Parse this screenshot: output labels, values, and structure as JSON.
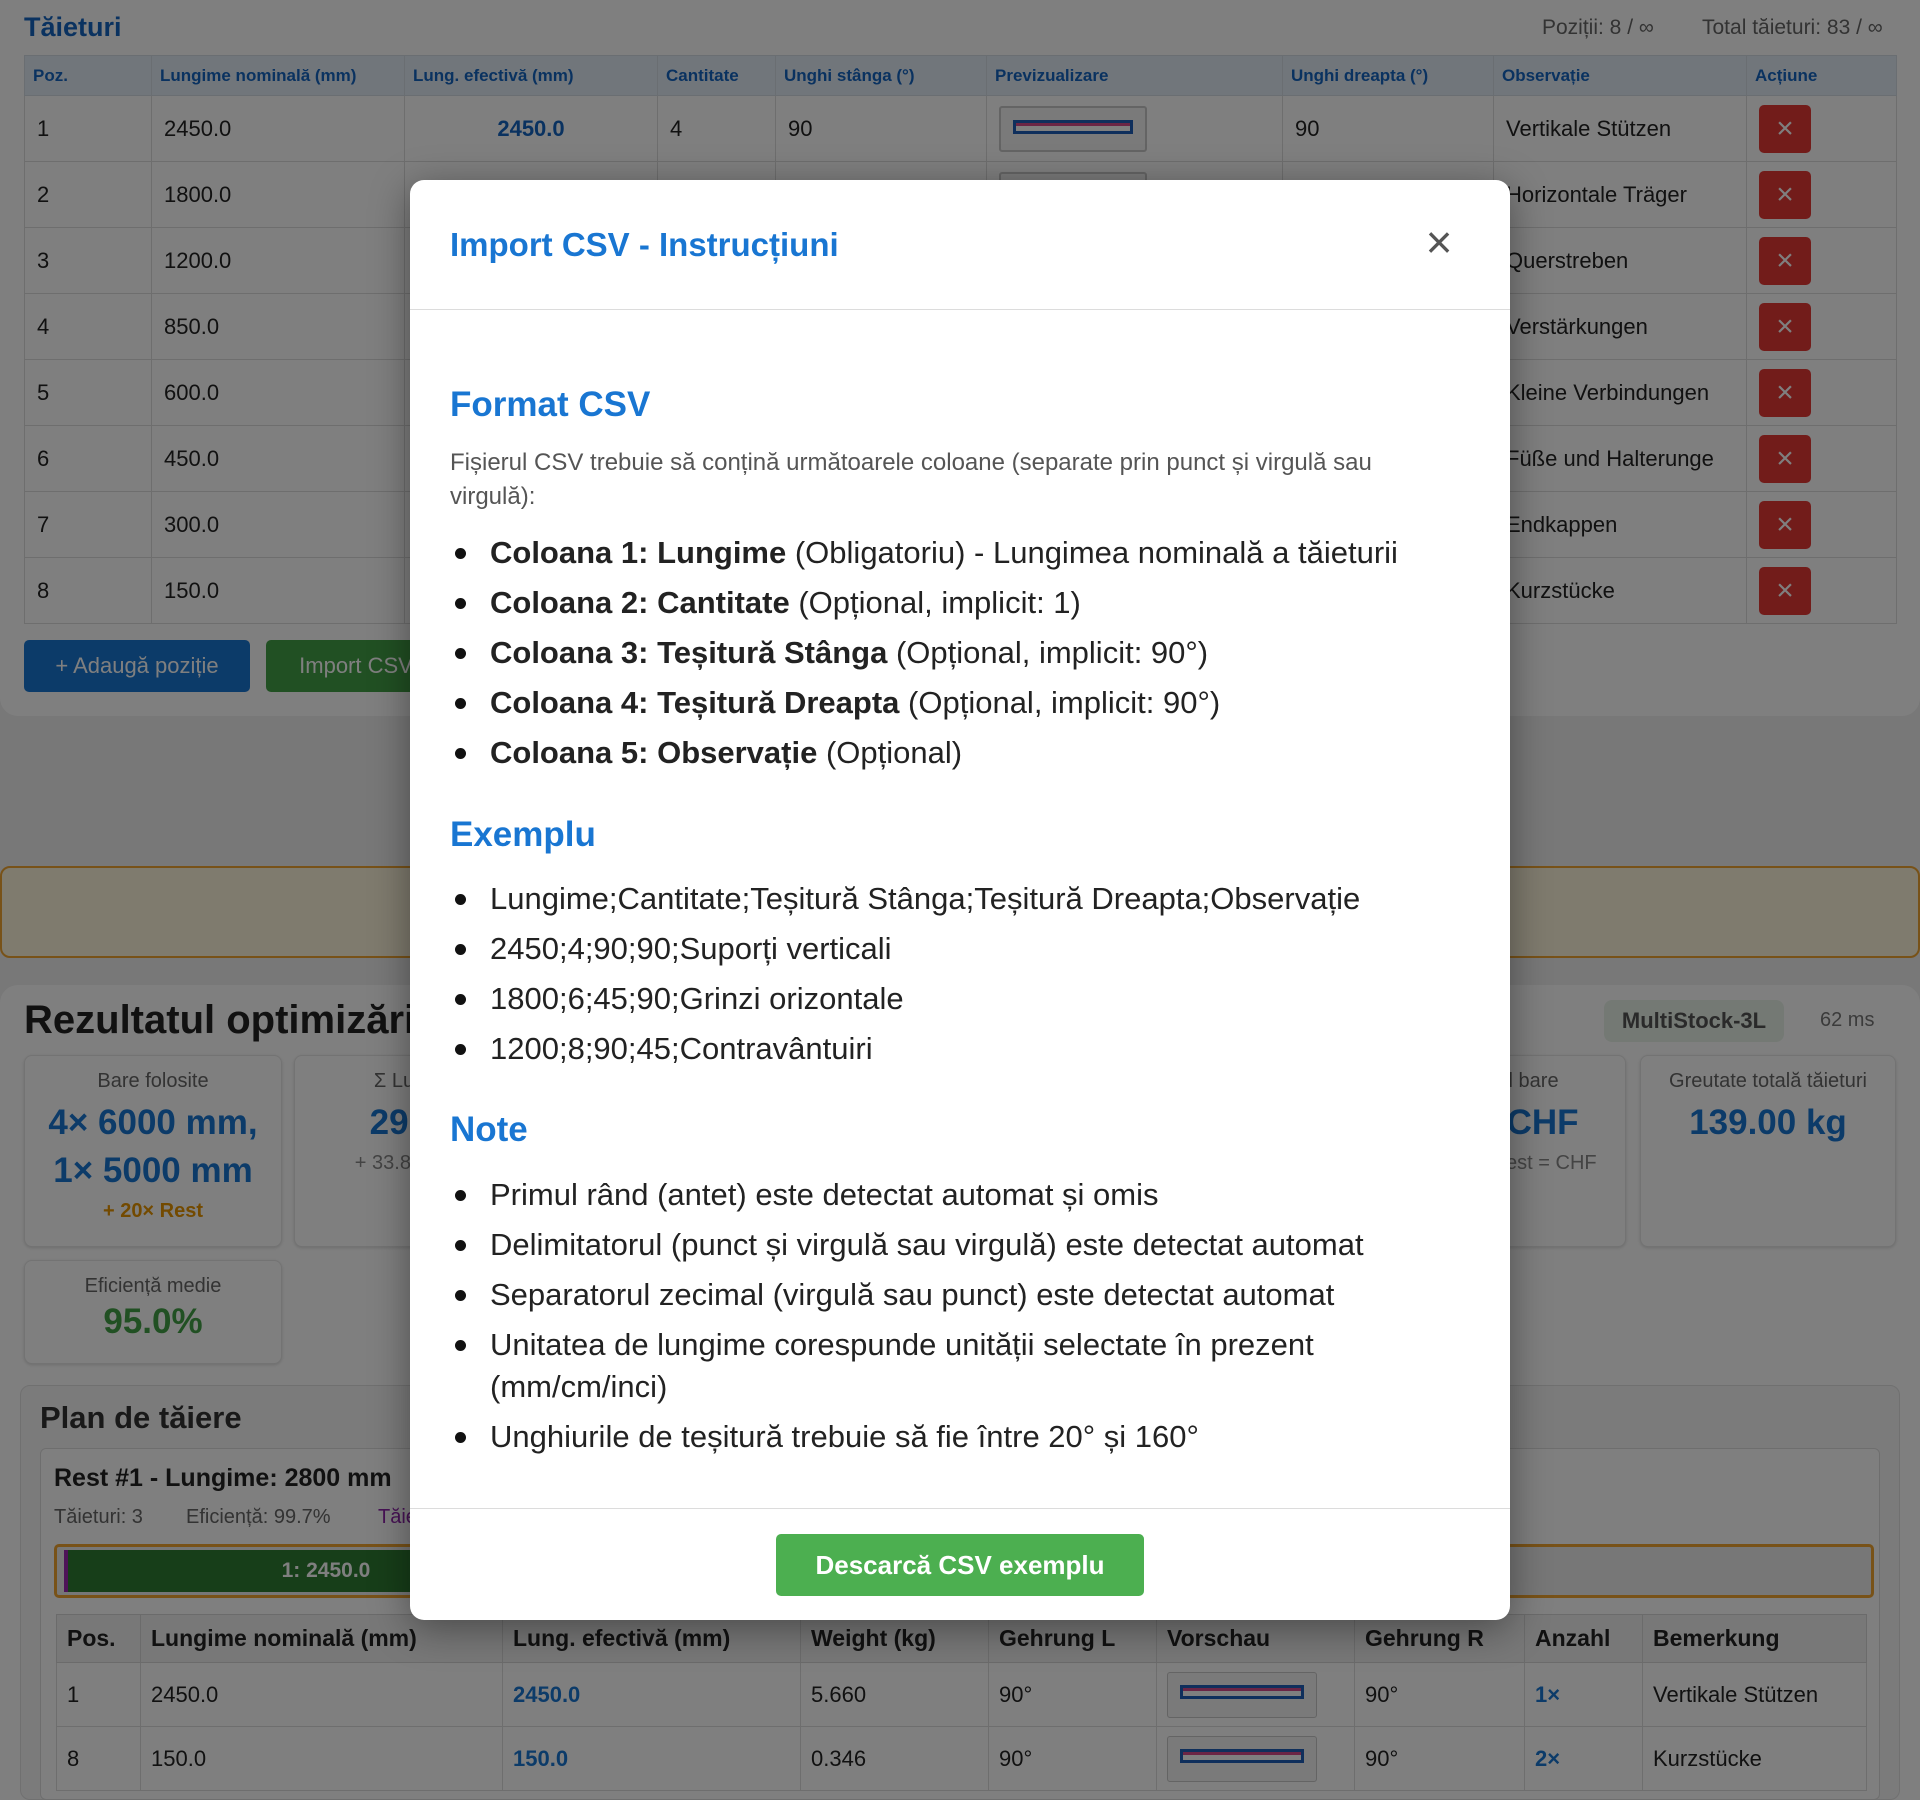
{
  "cuts": {
    "title": "Tăieturi",
    "positions_label": "Poziții: 8 / ∞",
    "total_label": "Total tăieturi: 83 / ∞",
    "headers": [
      "Poz.",
      "Lungime nominală (mm)",
      "Lung. efectivă (mm)",
      "Cantitate",
      "Unghi stânga (°)",
      "Previzualizare",
      "Unghi dreapta (°)",
      "Observație",
      "Acțiune"
    ],
    "rows": [
      {
        "pos": "1",
        "nominal": "2450.0",
        "effective": "2450.0",
        "qty": "4",
        "angle_left": "90",
        "angle_right": "90",
        "note": "Vertikale Stützen"
      },
      {
        "pos": "2",
        "nominal": "1800.0",
        "effective": "",
        "qty": "",
        "angle_left": "",
        "angle_right": "",
        "note": "Horizontale Träger"
      },
      {
        "pos": "3",
        "nominal": "1200.0",
        "effective": "",
        "qty": "",
        "angle_left": "",
        "angle_right": "",
        "note": "Querstreben"
      },
      {
        "pos": "4",
        "nominal": "850.0",
        "effective": "",
        "qty": "",
        "angle_left": "",
        "angle_right": "",
        "note": "Verstärkungen"
      },
      {
        "pos": "5",
        "nominal": "600.0",
        "effective": "",
        "qty": "",
        "angle_left": "",
        "angle_right": "",
        "note": "Kleine Verbindungen"
      },
      {
        "pos": "6",
        "nominal": "450.0",
        "effective": "",
        "qty": "",
        "angle_left": "",
        "angle_right": "",
        "note": "Füße und Halterunge"
      },
      {
        "pos": "7",
        "nominal": "300.0",
        "effective": "",
        "qty": "",
        "angle_left": "",
        "angle_right": "",
        "note": "Endkappen"
      },
      {
        "pos": "8",
        "nominal": "150.0",
        "effective": "",
        "qty": "",
        "angle_left": "",
        "angle_right": "",
        "note": "Kurzstücke"
      }
    ],
    "delete_icon": "×",
    "add_button": "+ Adaugă poziție",
    "import_button": "Import CSV"
  },
  "results": {
    "title": "Rezultatul optimizării",
    "algorithm": "MultiStock-3L",
    "time": "62 ms",
    "cards": {
      "bars_used": {
        "label": "Bare folosite",
        "value": "4× 6000 mm, 1× 5000 mm",
        "sub": "+ 20× Rest"
      },
      "sum_length": {
        "label": "Σ Lu",
        "value": "29.",
        "sub": "+ 33.8 m"
      },
      "cost": {
        "label": "al bare",
        "value": "5 CHF",
        "sub": "HF Rest = CHF"
      },
      "weight": {
        "label": "Greutate totală tăieturi",
        "value": "139.00 kg"
      },
      "efficiency": {
        "label": "Eficiență medie",
        "value": "95.0%"
      }
    },
    "plan": {
      "title": "Plan de tăiere",
      "rest_title": "Rest #1 - Lungime: 2800 mm",
      "cuts_count": "Tăieturi: 3",
      "efficiency": "Eficiență: 99.7%",
      "cuts_link": "Tăie",
      "segment_label": "1: 2450.0",
      "headers": [
        "Pos.",
        "Lungime nominală (mm)",
        "Lung. efectivă (mm)",
        "Weight (kg)",
        "Gehrung L",
        "Vorschau",
        "Gehrung R",
        "Anzahl",
        "Bemerkung"
      ],
      "rows": [
        {
          "pos": "1",
          "nominal": "2450.0",
          "effective": "2450.0",
          "weight": "5.660",
          "gl": "90°",
          "gr": "90°",
          "count": "1×",
          "note": "Vertikale Stützen"
        },
        {
          "pos": "8",
          "nominal": "150.0",
          "effective": "150.0",
          "weight": "0.346",
          "gl": "90°",
          "gr": "90°",
          "count": "2×",
          "note": "Kurzstücke"
        }
      ]
    }
  },
  "modal": {
    "title": "Import CSV - Instrucțiuni",
    "close_icon": "×",
    "format_heading": "Format CSV",
    "format_intro": "Fișierul CSV trebuie să conțină următoarele coloane (separate prin punct și virgulă sau virgulă):",
    "columns": [
      {
        "label": "Coloana 1: Lungime",
        "desc": " (Obligatoriu) - Lungimea nominală a tăieturii"
      },
      {
        "label": "Coloana 2: Cantitate",
        "desc": " (Opțional, implicit: 1)"
      },
      {
        "label": "Coloana 3: Teșitură Stânga",
        "desc": " (Opțional, implicit: 90°)"
      },
      {
        "label": "Coloana 4: Teșitură Dreapta",
        "desc": " (Opțional, implicit: 90°)"
      },
      {
        "label": "Coloana 5: Observație",
        "desc": " (Opțional)"
      }
    ],
    "example_heading": "Exemplu",
    "example_lines": [
      "Lungime;Cantitate;Teșitură Stânga;Teșitură Dreapta;Observație",
      "2450;4;90;90;Suporți verticali",
      "1800;6;45;90;Grinzi orizontale",
      "1200;8;90;45;Contravântuiri"
    ],
    "notes_heading": "Note",
    "notes": [
      "Primul rând (antet) este detectat automat și omis",
      "Delimitatorul (punct și virgulă sau virgulă) este detectat automat",
      "Separatorul zecimal (virgulă sau punct) este detectat automat",
      "Unitatea de lungime corespunde unității selectate în prezent (mm/cm/inci)",
      "Unghiurile de teșitură trebuie să fie între 20° și 160°"
    ],
    "download_button": "Descarcă CSV exemplu"
  },
  "colors": {
    "primary": "#1976d2",
    "success": "#4caf50",
    "danger": "#e53935",
    "warning": "#f0a530"
  }
}
